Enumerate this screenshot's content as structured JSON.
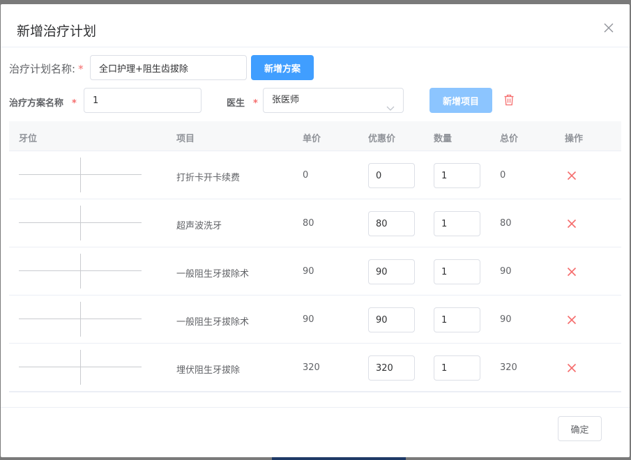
{
  "dialog": {
    "title": "新增治疗计划"
  },
  "plan": {
    "name_label": "治疗计划名称:",
    "required_mark": "*",
    "name_value": "全口护理+阻生齿拔除",
    "add_plan_label": "新增方案"
  },
  "scheme": {
    "name_label": "治疗方案名称",
    "required_mark": "*",
    "name_value": "1",
    "doctor_label": "医生",
    "doctor_required_mark": "*",
    "doctor_selected": "张医师",
    "add_item_label": "新增项目"
  },
  "table": {
    "headers": [
      "牙位",
      "项目",
      "单价",
      "优惠价",
      "数量",
      "总价",
      "操作"
    ],
    "rows": [
      {
        "item": "打折卡开卡续费",
        "price": "0",
        "discount": "0",
        "qty": "1",
        "total": "0"
      },
      {
        "item": "超声波洗牙",
        "price": "80",
        "discount": "80",
        "qty": "1",
        "total": "80"
      },
      {
        "item": "一般阻生牙拔除术",
        "price": "90",
        "discount": "90",
        "qty": "1",
        "total": "90"
      },
      {
        "item": "一般阻生牙拔除术",
        "price": "90",
        "discount": "90",
        "qty": "1",
        "total": "90"
      },
      {
        "item": "埋伏阻生牙拔除",
        "price": "320",
        "discount": "320",
        "qty": "1",
        "total": "320"
      }
    ]
  },
  "footer": {
    "confirm_label": "确定"
  },
  "colors": {
    "primary": "#409eff",
    "primary_disabled": "#8cc5ff",
    "danger": "#f56c6c"
  }
}
